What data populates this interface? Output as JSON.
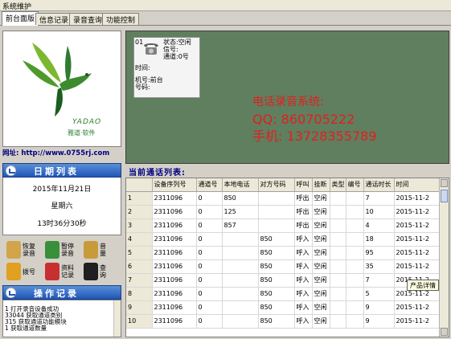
{
  "window": {
    "title": "系统维护"
  },
  "tabs": [
    {
      "label": "前台面版",
      "active": true
    },
    {
      "label": "信息记录",
      "active": false
    },
    {
      "label": "录音查询",
      "active": false
    },
    {
      "label": "功能控制",
      "active": false
    }
  ],
  "logo": {
    "brand_en": "YADAO",
    "brand_cn": "雅道·软件"
  },
  "website": "网址: http://www.0755rj.com",
  "date_panel": {
    "title": "日期列表",
    "date": "2015年11月21日",
    "weekday": "星期六",
    "time": "13时36分30秒"
  },
  "tool_buttons": [
    {
      "label": "恢复录音",
      "icon": "record-restore-icon",
      "color": "#d2a54a"
    },
    {
      "label": "暂停录音",
      "icon": "pause-record-icon",
      "color": "#3a8f3a"
    },
    {
      "label": "音量",
      "icon": "volume-icon",
      "color": "#c89a3a"
    },
    {
      "label": "拨号",
      "icon": "dial-phone-icon",
      "color": "#e0a020"
    },
    {
      "label": "资料记录",
      "icon": "data-record-icon",
      "color": "#c83030"
    },
    {
      "label": "查询",
      "icon": "query-microphone-icon",
      "color": "#202020"
    }
  ],
  "log_panel": {
    "title": "操作记录",
    "lines": [
      "1    打开录音设备成功",
      "33044    获取通道类别",
      "315    获取通道功能模块",
      "1    获取通道数量"
    ]
  },
  "line_card": {
    "line_no": "01",
    "status": "状态:空闲",
    "signal": "信号:",
    "channel": "通道:0号",
    "time": "时间:",
    "extension": "机号:前台",
    "number": "号码:"
  },
  "promo": {
    "line1": "电话录音系统:",
    "line2": "QQ: 860705222",
    "line3": "手机: 13728355789"
  },
  "call_list": {
    "title": "当前通话列表:",
    "columns": [
      "",
      "设备序列号",
      "通道号",
      "本地电话",
      "对方号码",
      "呼叫",
      "挂断",
      "类型",
      "编号",
      "通话时长",
      "时间"
    ],
    "rows": [
      [
        "1",
        "2311096",
        "0",
        "850",
        "",
        "呼出",
        "空闲",
        "",
        "",
        "7",
        "2015-11-2"
      ],
      [
        "2",
        "2311096",
        "0",
        "125",
        "",
        "呼出",
        "空闲",
        "",
        "",
        "10",
        "2015-11-2"
      ],
      [
        "3",
        "2311096",
        "0",
        "857",
        "",
        "呼出",
        "空闲",
        "",
        "",
        "4",
        "2015-11-2"
      ],
      [
        "4",
        "2311096",
        "0",
        "",
        "850",
        "呼入",
        "空闲",
        "",
        "",
        "18",
        "2015-11-2"
      ],
      [
        "5",
        "2311096",
        "0",
        "",
        "850",
        "呼入",
        "空闲",
        "",
        "",
        "95",
        "2015-11-2"
      ],
      [
        "6",
        "2311096",
        "0",
        "",
        "850",
        "呼入",
        "空闲",
        "",
        "",
        "35",
        "2015-11-2"
      ],
      [
        "7",
        "2311096",
        "0",
        "",
        "850",
        "呼入",
        "空闲",
        "",
        "",
        "7",
        "2015-11-2"
      ],
      [
        "8",
        "2311096",
        "0",
        "",
        "850",
        "呼入",
        "空闲",
        "",
        "",
        "5",
        "2015-11-2"
      ],
      [
        "9",
        "2311096",
        "0",
        "",
        "850",
        "呼入",
        "空闲",
        "",
        "",
        "9",
        "2015-11-2"
      ],
      [
        "10",
        "2311096",
        "0",
        "",
        "850",
        "呼入",
        "空闲",
        "",
        "",
        "9",
        "2015-11-2"
      ]
    ]
  },
  "tooltip": "产品详情",
  "colors": {
    "monitor_bg": "#5f7f5e",
    "promo_text": "#e02020",
    "header_blue": "#1f56b8",
    "brand_green": "#2e7d32"
  }
}
